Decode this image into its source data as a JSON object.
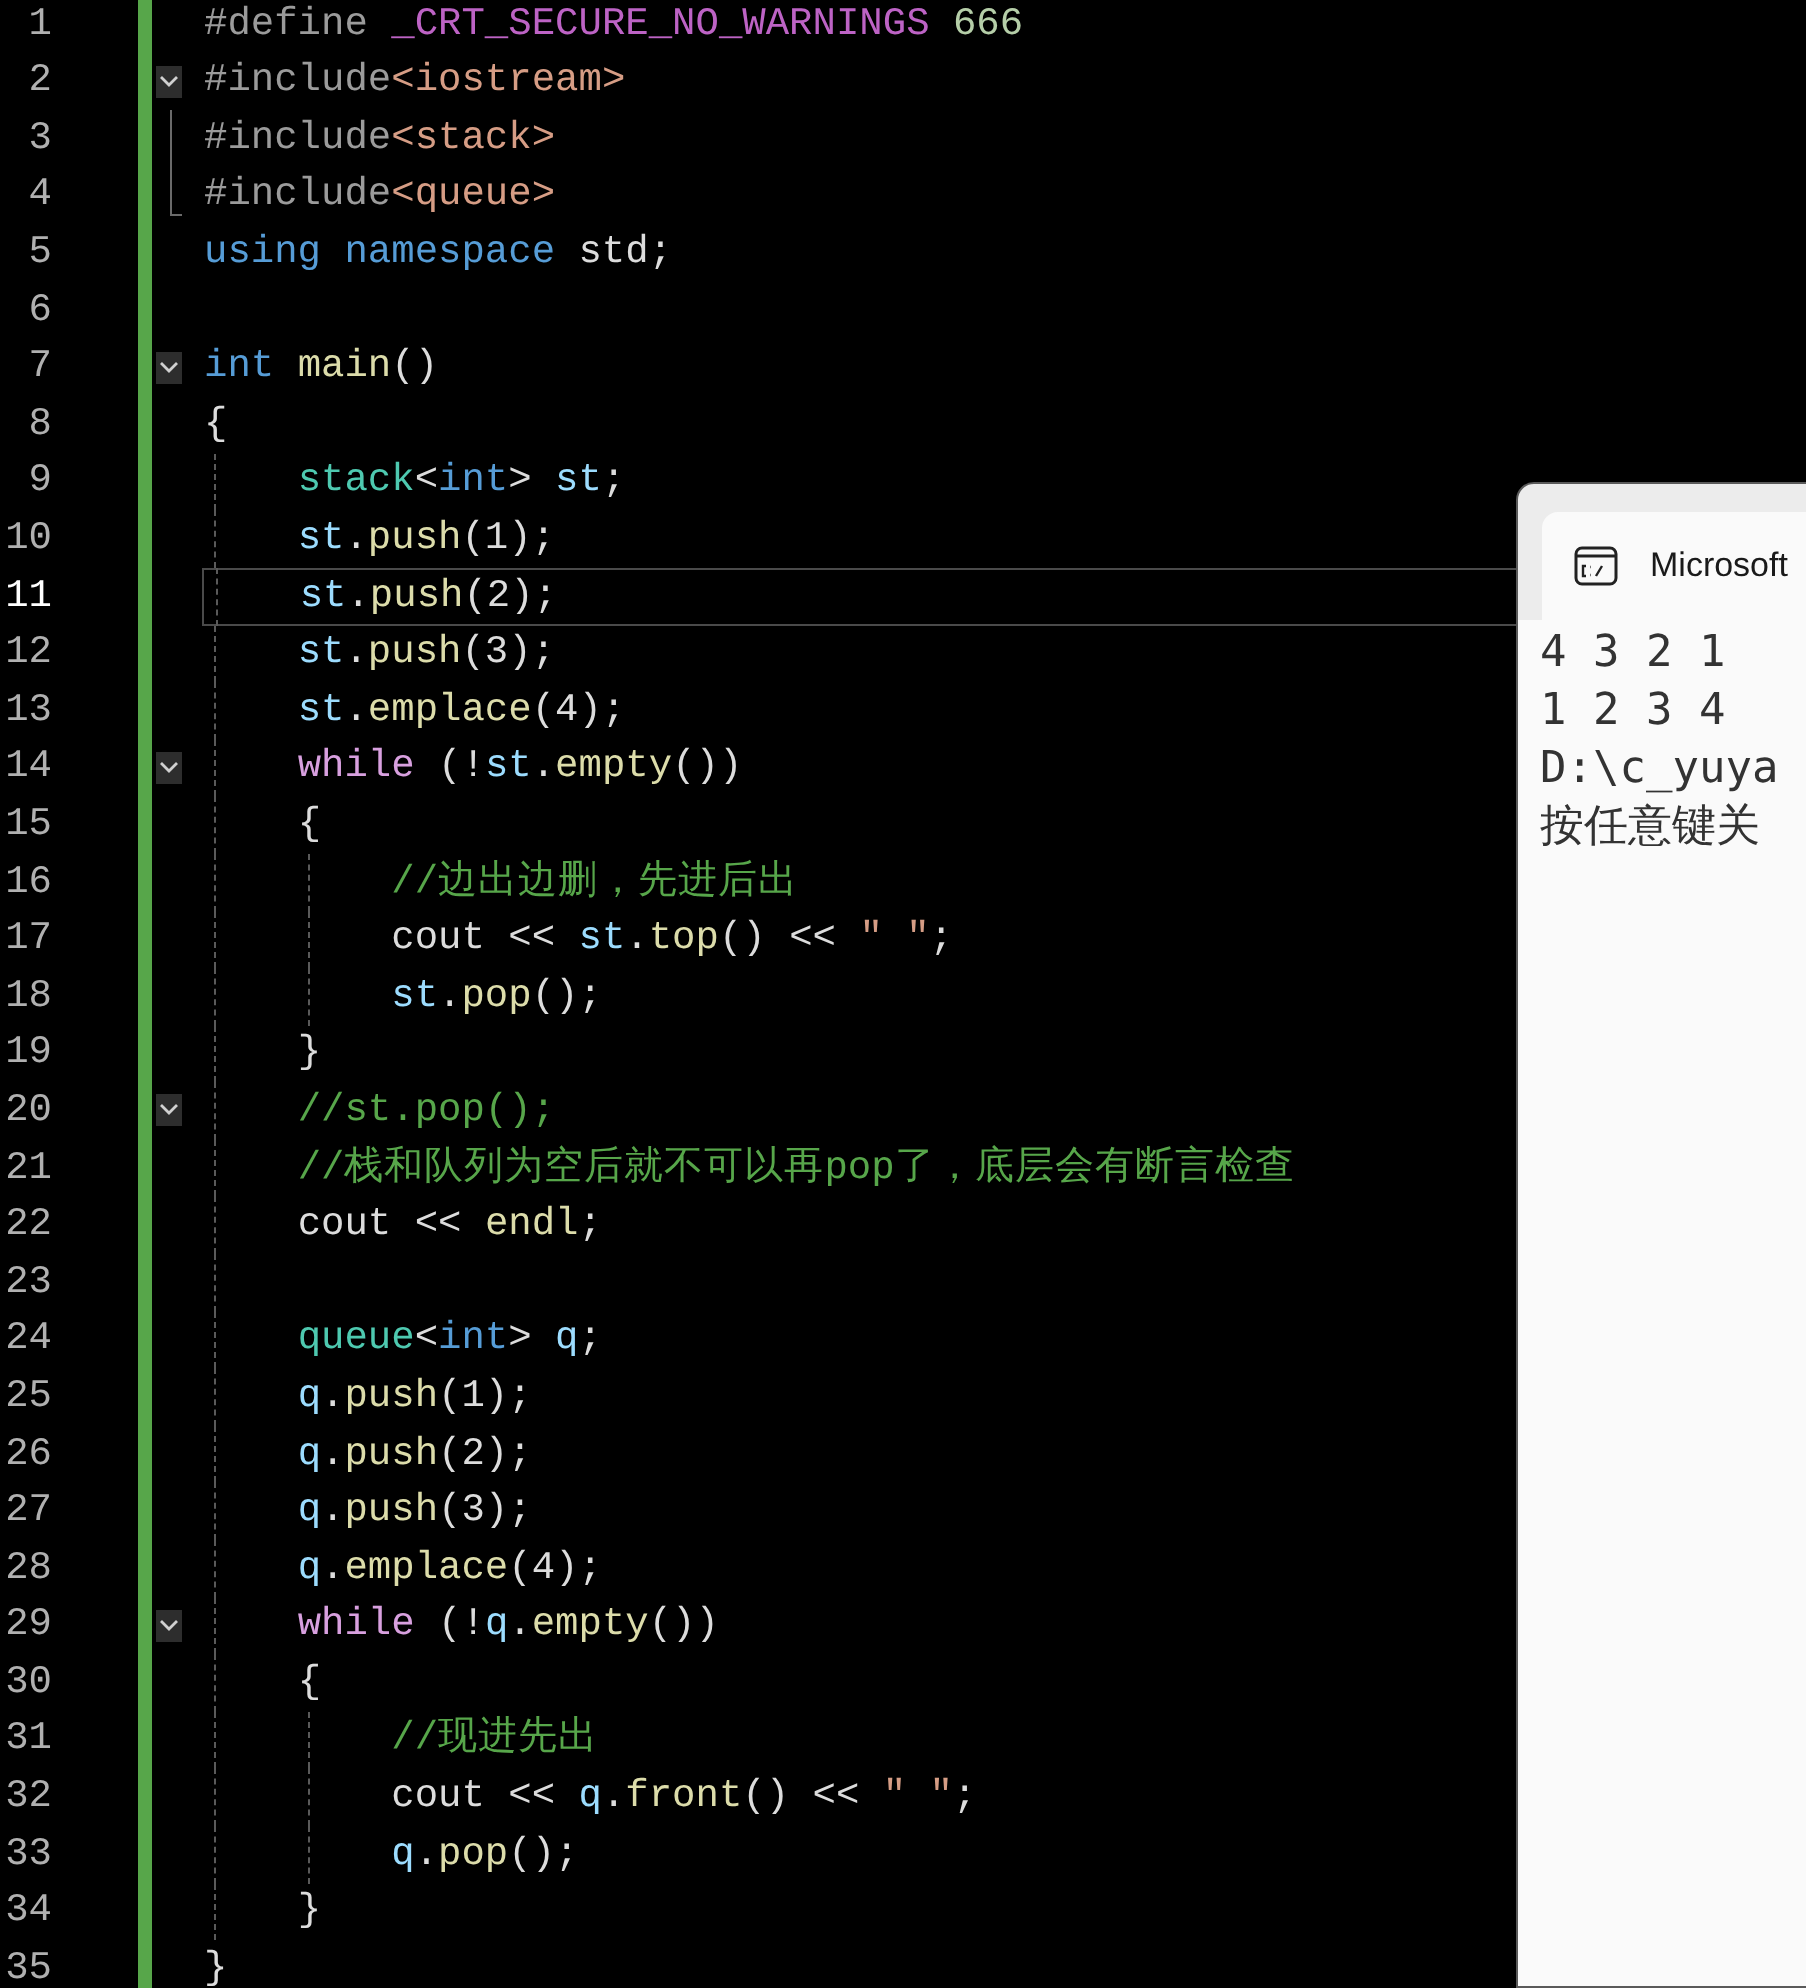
{
  "editor": {
    "lines": [
      {
        "number": "1",
        "fold": false,
        "selected": false,
        "tokens": [
          {
            "text": "#define",
            "kind": "preproc"
          },
          {
            "text": " _CRT_SECURE_NO_WARNINGS",
            "kind": "macro"
          },
          {
            "text": " 666",
            "kind": "number"
          }
        ]
      },
      {
        "number": "2",
        "fold": true,
        "selected": false,
        "tokens": [
          {
            "text": "#include",
            "kind": "preproc"
          },
          {
            "text": "<iostream>",
            "kind": "string"
          }
        ]
      },
      {
        "number": "3",
        "fold": false,
        "selected": false,
        "tokens": [
          {
            "text": "#include",
            "kind": "preproc"
          },
          {
            "text": "<stack>",
            "kind": "string"
          }
        ]
      },
      {
        "number": "4",
        "fold": false,
        "selected": false,
        "tokens": [
          {
            "text": "#include",
            "kind": "preproc"
          },
          {
            "text": "<queue>",
            "kind": "string"
          }
        ]
      },
      {
        "number": "5",
        "fold": false,
        "selected": false,
        "tokens": [
          {
            "text": "using namespace",
            "kind": "keyword"
          },
          {
            "text": " std;",
            "kind": "plain"
          }
        ]
      },
      {
        "number": "6",
        "fold": false,
        "selected": false
      },
      {
        "number": "7",
        "fold": true,
        "selected": false,
        "tokens": [
          {
            "text": "int",
            "kind": "keyword"
          },
          {
            "text": " main",
            "kind": "func"
          },
          {
            "text": "()",
            "kind": "plain"
          }
        ]
      },
      {
        "number": "8",
        "fold": false,
        "selected": false,
        "tokens": [
          {
            "text": "{",
            "kind": "plain"
          }
        ]
      },
      {
        "number": "9",
        "fold": false,
        "selected": false,
        "tokens": [
          {
            "text": "    stack",
            "kind": "type"
          },
          {
            "text": "<",
            "kind": "plain"
          },
          {
            "text": "int",
            "kind": "keyword"
          },
          {
            "text": ">",
            "kind": "plain"
          },
          {
            "text": " st",
            "kind": "var"
          },
          {
            "text": ";",
            "kind": "plain"
          }
        ]
      },
      {
        "number": "10",
        "fold": false,
        "selected": false,
        "tokens": [
          {
            "text": "    st",
            "kind": "var"
          },
          {
            "text": ".",
            "kind": "plain"
          },
          {
            "text": "push",
            "kind": "func"
          },
          {
            "text": "(1);",
            "kind": "plain"
          }
        ]
      },
      {
        "number": "11",
        "fold": false,
        "selected": true,
        "tokens": [
          {
            "text": "    st",
            "kind": "var"
          },
          {
            "text": ".",
            "kind": "plain"
          },
          {
            "text": "push",
            "kind": "func"
          },
          {
            "text": "(2);",
            "kind": "plain"
          }
        ]
      },
      {
        "number": "12",
        "fold": false,
        "selected": false,
        "tokens": [
          {
            "text": "    st",
            "kind": "var"
          },
          {
            "text": ".",
            "kind": "plain"
          },
          {
            "text": "push",
            "kind": "func"
          },
          {
            "text": "(3);",
            "kind": "plain"
          }
        ]
      },
      {
        "number": "13",
        "fold": false,
        "selected": false,
        "tokens": [
          {
            "text": "    st",
            "kind": "var"
          },
          {
            "text": ".",
            "kind": "plain"
          },
          {
            "text": "emplace",
            "kind": "func"
          },
          {
            "text": "(4);",
            "kind": "plain"
          }
        ]
      },
      {
        "number": "14",
        "fold": true,
        "selected": false,
        "tokens": [
          {
            "text": "    while",
            "kind": "control"
          },
          {
            "text": " (!",
            "kind": "plain"
          },
          {
            "text": "st",
            "kind": "var"
          },
          {
            "text": ".",
            "kind": "plain"
          },
          {
            "text": "empty",
            "kind": "func"
          },
          {
            "text": "())",
            "kind": "plain"
          }
        ]
      },
      {
        "number": "15",
        "fold": false,
        "selected": false,
        "tokens": [
          {
            "text": "    {",
            "kind": "plain"
          }
        ]
      },
      {
        "number": "16",
        "fold": false,
        "selected": false,
        "tokens": [
          {
            "text": "        //边出边删，先进后出",
            "kind": "comment"
          }
        ]
      },
      {
        "number": "17",
        "fold": false,
        "selected": false,
        "tokens": [
          {
            "text": "        cout << ",
            "kind": "plain"
          },
          {
            "text": "st",
            "kind": "var"
          },
          {
            "text": ".",
            "kind": "plain"
          },
          {
            "text": "top",
            "kind": "func"
          },
          {
            "text": "() << ",
            "kind": "plain"
          },
          {
            "text": "\" \"",
            "kind": "string"
          },
          {
            "text": ";",
            "kind": "plain"
          }
        ]
      },
      {
        "number": "18",
        "fold": false,
        "selected": false,
        "tokens": [
          {
            "text": "        st",
            "kind": "var"
          },
          {
            "text": ".",
            "kind": "plain"
          },
          {
            "text": "pop",
            "kind": "func"
          },
          {
            "text": "();",
            "kind": "plain"
          }
        ]
      },
      {
        "number": "19",
        "fold": false,
        "selected": false,
        "tokens": [
          {
            "text": "    }",
            "kind": "plain"
          }
        ]
      },
      {
        "number": "20",
        "fold": true,
        "selected": false,
        "tokens": [
          {
            "text": "    //st.pop();",
            "kind": "comment"
          }
        ]
      },
      {
        "number": "21",
        "fold": false,
        "selected": false,
        "tokens": [
          {
            "text": "    //栈和队列为空后就不可以再pop了，底层会有断言检查",
            "kind": "comment"
          }
        ]
      },
      {
        "number": "22",
        "fold": false,
        "selected": false,
        "tokens": [
          {
            "text": "    cout << ",
            "kind": "plain"
          },
          {
            "text": "endl",
            "kind": "func"
          },
          {
            "text": ";",
            "kind": "plain"
          }
        ]
      },
      {
        "number": "23",
        "fold": false,
        "selected": false
      },
      {
        "number": "24",
        "fold": false,
        "selected": false,
        "tokens": [
          {
            "text": "    queue",
            "kind": "type"
          },
          {
            "text": "<",
            "kind": "plain"
          },
          {
            "text": "int",
            "kind": "keyword"
          },
          {
            "text": ">",
            "kind": "plain"
          },
          {
            "text": " q",
            "kind": "var"
          },
          {
            "text": ";",
            "kind": "plain"
          }
        ]
      },
      {
        "number": "25",
        "fold": false,
        "selected": false,
        "tokens": [
          {
            "text": "    q",
            "kind": "var"
          },
          {
            "text": ".",
            "kind": "plain"
          },
          {
            "text": "push",
            "kind": "func"
          },
          {
            "text": "(1);",
            "kind": "plain"
          }
        ]
      },
      {
        "number": "26",
        "fold": false,
        "selected": false,
        "tokens": [
          {
            "text": "    q",
            "kind": "var"
          },
          {
            "text": ".",
            "kind": "plain"
          },
          {
            "text": "push",
            "kind": "func"
          },
          {
            "text": "(2);",
            "kind": "plain"
          }
        ]
      },
      {
        "number": "27",
        "fold": false,
        "selected": false,
        "tokens": [
          {
            "text": "    q",
            "kind": "var"
          },
          {
            "text": ".",
            "kind": "plain"
          },
          {
            "text": "push",
            "kind": "func"
          },
          {
            "text": "(3);",
            "kind": "plain"
          }
        ]
      },
      {
        "number": "28",
        "fold": false,
        "selected": false,
        "tokens": [
          {
            "text": "    q",
            "kind": "var"
          },
          {
            "text": ".",
            "kind": "plain"
          },
          {
            "text": "emplace",
            "kind": "func"
          },
          {
            "text": "(4);",
            "kind": "plain"
          }
        ]
      },
      {
        "number": "29",
        "fold": true,
        "selected": false,
        "tokens": [
          {
            "text": "    while",
            "kind": "control"
          },
          {
            "text": " (!",
            "kind": "plain"
          },
          {
            "text": "q",
            "kind": "var"
          },
          {
            "text": ".",
            "kind": "plain"
          },
          {
            "text": "empty",
            "kind": "func"
          },
          {
            "text": "())",
            "kind": "plain"
          }
        ]
      },
      {
        "number": "30",
        "fold": false,
        "selected": false,
        "tokens": [
          {
            "text": "    {",
            "kind": "plain"
          }
        ]
      },
      {
        "number": "31",
        "fold": false,
        "selected": false,
        "tokens": [
          {
            "text": "        //现进先出",
            "kind": "comment"
          }
        ]
      },
      {
        "number": "32",
        "fold": false,
        "selected": false,
        "tokens": [
          {
            "text": "        cout << ",
            "kind": "plain"
          },
          {
            "text": "q",
            "kind": "var"
          },
          {
            "text": ".",
            "kind": "plain"
          },
          {
            "text": "front",
            "kind": "func"
          },
          {
            "text": "() << ",
            "kind": "plain"
          },
          {
            "text": "\" \"",
            "kind": "string"
          },
          {
            "text": ";",
            "kind": "plain"
          }
        ]
      },
      {
        "number": "33",
        "fold": false,
        "selected": false,
        "tokens": [
          {
            "text": "        q",
            "kind": "var"
          },
          {
            "text": ".",
            "kind": "plain"
          },
          {
            "text": "pop",
            "kind": "func"
          },
          {
            "text": "();",
            "kind": "plain"
          }
        ]
      },
      {
        "number": "34",
        "fold": false,
        "selected": false,
        "tokens": [
          {
            "text": "    }",
            "kind": "plain"
          }
        ]
      },
      {
        "number": "35",
        "fold": false,
        "selected": false,
        "tokens": [
          {
            "text": "}",
            "kind": "plain"
          }
        ]
      }
    ]
  },
  "console": {
    "tab_title": "Microsoft",
    "lines": [
      "4 3 2 1",
      "1 2 3 4",
      "D:\\c_yuya",
      "按任意键关"
    ]
  }
}
